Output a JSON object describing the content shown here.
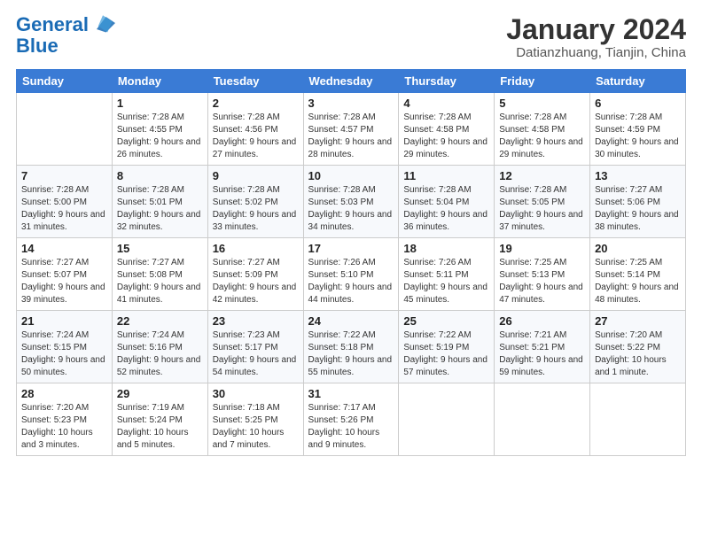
{
  "logo": {
    "line1": "General",
    "line2": "Blue"
  },
  "header": {
    "month": "January 2024",
    "location": "Datianzhuang, Tianjin, China"
  },
  "weekdays": [
    "Sunday",
    "Monday",
    "Tuesday",
    "Wednesday",
    "Thursday",
    "Friday",
    "Saturday"
  ],
  "weeks": [
    [
      {
        "day": "",
        "sunrise": "",
        "sunset": "",
        "daylight": ""
      },
      {
        "day": "1",
        "sunrise": "7:28 AM",
        "sunset": "4:55 PM",
        "daylight": "9 hours and 26 minutes."
      },
      {
        "day": "2",
        "sunrise": "7:28 AM",
        "sunset": "4:56 PM",
        "daylight": "9 hours and 27 minutes."
      },
      {
        "day": "3",
        "sunrise": "7:28 AM",
        "sunset": "4:57 PM",
        "daylight": "9 hours and 28 minutes."
      },
      {
        "day": "4",
        "sunrise": "7:28 AM",
        "sunset": "4:58 PM",
        "daylight": "9 hours and 29 minutes."
      },
      {
        "day": "5",
        "sunrise": "7:28 AM",
        "sunset": "4:58 PM",
        "daylight": "9 hours and 29 minutes."
      },
      {
        "day": "6",
        "sunrise": "7:28 AM",
        "sunset": "4:59 PM",
        "daylight": "9 hours and 30 minutes."
      }
    ],
    [
      {
        "day": "7",
        "sunrise": "7:28 AM",
        "sunset": "5:00 PM",
        "daylight": "9 hours and 31 minutes."
      },
      {
        "day": "8",
        "sunrise": "7:28 AM",
        "sunset": "5:01 PM",
        "daylight": "9 hours and 32 minutes."
      },
      {
        "day": "9",
        "sunrise": "7:28 AM",
        "sunset": "5:02 PM",
        "daylight": "9 hours and 33 minutes."
      },
      {
        "day": "10",
        "sunrise": "7:28 AM",
        "sunset": "5:03 PM",
        "daylight": "9 hours and 34 minutes."
      },
      {
        "day": "11",
        "sunrise": "7:28 AM",
        "sunset": "5:04 PM",
        "daylight": "9 hours and 36 minutes."
      },
      {
        "day": "12",
        "sunrise": "7:28 AM",
        "sunset": "5:05 PM",
        "daylight": "9 hours and 37 minutes."
      },
      {
        "day": "13",
        "sunrise": "7:27 AM",
        "sunset": "5:06 PM",
        "daylight": "9 hours and 38 minutes."
      }
    ],
    [
      {
        "day": "14",
        "sunrise": "7:27 AM",
        "sunset": "5:07 PM",
        "daylight": "9 hours and 39 minutes."
      },
      {
        "day": "15",
        "sunrise": "7:27 AM",
        "sunset": "5:08 PM",
        "daylight": "9 hours and 41 minutes."
      },
      {
        "day": "16",
        "sunrise": "7:27 AM",
        "sunset": "5:09 PM",
        "daylight": "9 hours and 42 minutes."
      },
      {
        "day": "17",
        "sunrise": "7:26 AM",
        "sunset": "5:10 PM",
        "daylight": "9 hours and 44 minutes."
      },
      {
        "day": "18",
        "sunrise": "7:26 AM",
        "sunset": "5:11 PM",
        "daylight": "9 hours and 45 minutes."
      },
      {
        "day": "19",
        "sunrise": "7:25 AM",
        "sunset": "5:13 PM",
        "daylight": "9 hours and 47 minutes."
      },
      {
        "day": "20",
        "sunrise": "7:25 AM",
        "sunset": "5:14 PM",
        "daylight": "9 hours and 48 minutes."
      }
    ],
    [
      {
        "day": "21",
        "sunrise": "7:24 AM",
        "sunset": "5:15 PM",
        "daylight": "9 hours and 50 minutes."
      },
      {
        "day": "22",
        "sunrise": "7:24 AM",
        "sunset": "5:16 PM",
        "daylight": "9 hours and 52 minutes."
      },
      {
        "day": "23",
        "sunrise": "7:23 AM",
        "sunset": "5:17 PM",
        "daylight": "9 hours and 54 minutes."
      },
      {
        "day": "24",
        "sunrise": "7:22 AM",
        "sunset": "5:18 PM",
        "daylight": "9 hours and 55 minutes."
      },
      {
        "day": "25",
        "sunrise": "7:22 AM",
        "sunset": "5:19 PM",
        "daylight": "9 hours and 57 minutes."
      },
      {
        "day": "26",
        "sunrise": "7:21 AM",
        "sunset": "5:21 PM",
        "daylight": "9 hours and 59 minutes."
      },
      {
        "day": "27",
        "sunrise": "7:20 AM",
        "sunset": "5:22 PM",
        "daylight": "10 hours and 1 minute."
      }
    ],
    [
      {
        "day": "28",
        "sunrise": "7:20 AM",
        "sunset": "5:23 PM",
        "daylight": "10 hours and 3 minutes."
      },
      {
        "day": "29",
        "sunrise": "7:19 AM",
        "sunset": "5:24 PM",
        "daylight": "10 hours and 5 minutes."
      },
      {
        "day": "30",
        "sunrise": "7:18 AM",
        "sunset": "5:25 PM",
        "daylight": "10 hours and 7 minutes."
      },
      {
        "day": "31",
        "sunrise": "7:17 AM",
        "sunset": "5:26 PM",
        "daylight": "10 hours and 9 minutes."
      },
      {
        "day": "",
        "sunrise": "",
        "sunset": "",
        "daylight": ""
      },
      {
        "day": "",
        "sunrise": "",
        "sunset": "",
        "daylight": ""
      },
      {
        "day": "",
        "sunrise": "",
        "sunset": "",
        "daylight": ""
      }
    ]
  ],
  "labels": {
    "sunrise": "Sunrise:",
    "sunset": "Sunset:",
    "daylight": "Daylight:"
  }
}
